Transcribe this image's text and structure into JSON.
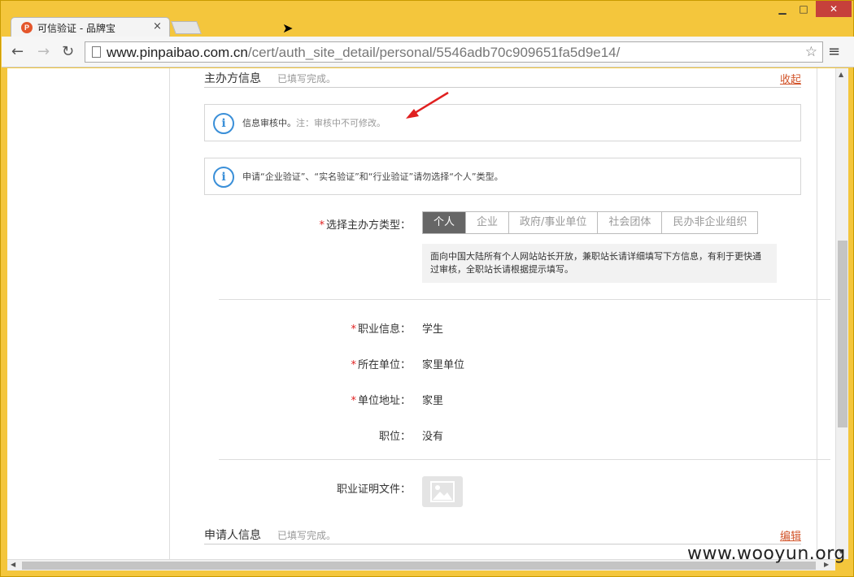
{
  "browser": {
    "tab_title": "可信验证 - 品牌宝",
    "tab_icon": "pinpaibao-logo-icon",
    "url_host": "www.pinpaibao.com.cn",
    "url_path": "/cert/auth_site_detail/personal/5546adb70c909651fa5d9e14/",
    "close_tab": "×"
  },
  "organizer_section": {
    "title": "主办方信息",
    "status": "已填写完成。",
    "toggle_label": "收起"
  },
  "notices": {
    "review": "信息审核中。",
    "review_note": "注：审核中不可修改。",
    "type_hint": "申请“企业验证”、“实名验证”和“行业验证”请勿选择“个人”类型。"
  },
  "organizer_type": {
    "label": "选择主办方类型：",
    "options": [
      "个人",
      "企业",
      "政府/事业单位",
      "社会团体",
      "民办非企业组织"
    ],
    "selected": "个人",
    "description": "面向中国大陆所有个人网站站长开放，兼职站长请详细填写下方信息，有利于更快通过审核，全职站长请根据提示填写。"
  },
  "fields": [
    {
      "label": "职业信息：",
      "value": "学生",
      "required": true
    },
    {
      "label": "所在单位：",
      "value": "家里单位",
      "required": true
    },
    {
      "label": "单位地址：",
      "value": "家里",
      "required": true
    },
    {
      "label": "职位：",
      "value": "没有",
      "required": false
    }
  ],
  "proof_file": {
    "label": "职业证明文件："
  },
  "applicant_section": {
    "title": "申请人信息",
    "status": "已填写完成。",
    "edit_label": "编辑"
  },
  "required_mark": "*",
  "watermark": "www.wooyun.org",
  "colors": {
    "window_frame": "#f4c63c",
    "link": "#d2542a",
    "info": "#3a8fd8",
    "required": "#e02020",
    "selected_option": "#666666"
  }
}
